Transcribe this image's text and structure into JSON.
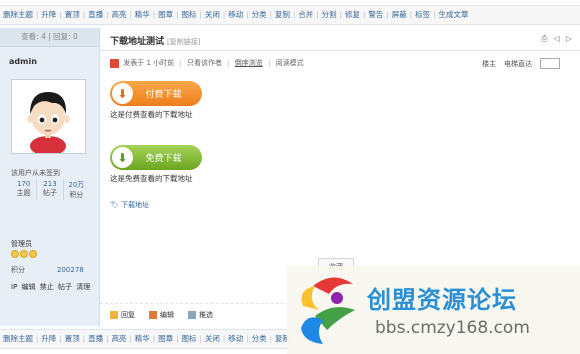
{
  "toolbar_top": [
    "删除主题",
    "升降",
    "置顶",
    "直播",
    "高亮",
    "精华",
    "图章",
    "图标",
    "关闭",
    "移动",
    "分类",
    "复制",
    "合并",
    "分割",
    "修复",
    "警告",
    "屏蔽",
    "标签",
    "生成文章"
  ],
  "toolbar_bottom": [
    "删除主题",
    "升降",
    "置顶",
    "直播",
    "高亮",
    "精华",
    "图章",
    "图标",
    "关闭",
    "移动",
    "分类",
    "复制"
  ],
  "sidebar": {
    "stats": "查看: 4 | 回复: 0",
    "username": "admin",
    "signature": "该用户从未签到",
    "stats_grid": [
      {
        "num": "170",
        "label": "主题"
      },
      {
        "num": "213",
        "label": "帖子"
      },
      {
        "num": "20万",
        "label": "积分"
      }
    ],
    "role": "管理员",
    "points_label": "积分",
    "points_value": "200278",
    "admin_links": [
      "IP",
      "编辑",
      "禁止",
      "帖子",
      "清理"
    ]
  },
  "post": {
    "title": "下载地址测试",
    "title_tag": "[复制链接]",
    "meta": {
      "posted": "发表于 1 小时前",
      "only_author": "只看该作者",
      "anti_theft": "倒序浏览",
      "read_mode": "阅读模式"
    },
    "meta_right": {
      "floor_owner": "楼主",
      "goto_floor": "电梯直达"
    },
    "paid_button": "付费下载",
    "paid_desc": "这是付费查看的下载地址",
    "free_button": "免费下载",
    "free_desc": "这是免费查看的下载地址",
    "download_link": "下载地址",
    "favorite": "收藏",
    "actions": [
      "回复",
      "编辑",
      "推选"
    ]
  },
  "watermark": {
    "cn": "创盟资源论坛",
    "url": "bbs.cmzy168.com"
  },
  "colors": {
    "link": "#336699",
    "paid": "#ee7d1b",
    "free": "#6aa520",
    "brand": "#2a8fd6"
  }
}
